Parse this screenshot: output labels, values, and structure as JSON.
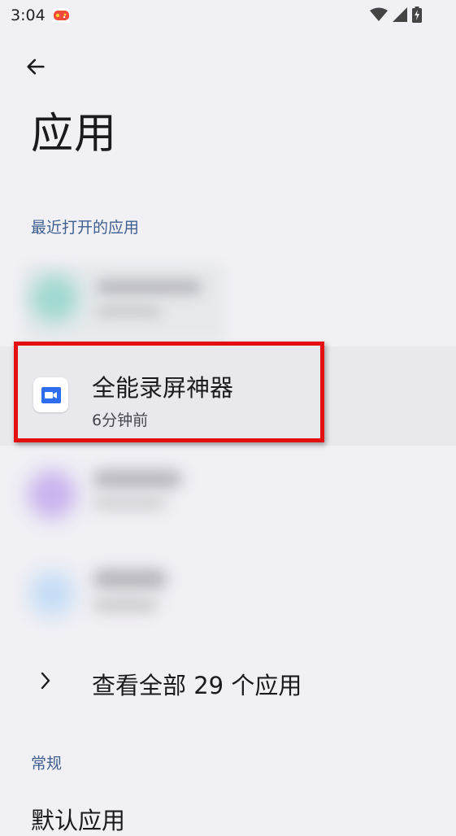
{
  "status_bar": {
    "time": "3:04"
  },
  "header": {
    "title": "应用"
  },
  "recent": {
    "header": "最近打开的应用",
    "items": [
      {
        "name": "",
        "time": "",
        "blurred": true
      },
      {
        "name": "全能录屏神器",
        "time": "6分钟前",
        "blurred": false
      },
      {
        "name": "",
        "time": "",
        "blurred": true
      },
      {
        "name": "",
        "time": "",
        "blurred": true
      }
    ]
  },
  "see_all": {
    "label": "查看全部 29 个应用"
  },
  "general": {
    "header": "常规",
    "first_item": "默认应用"
  },
  "colors": {
    "accent": "#3f5f8f",
    "highlight_frame": "#e41010",
    "background": "#f1f0f5"
  }
}
